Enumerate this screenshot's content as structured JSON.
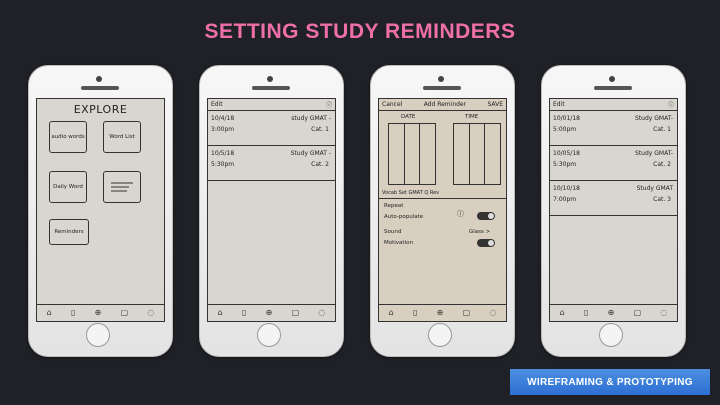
{
  "title": "SETTING STUDY REMINDERS",
  "badge": "WIREFRAMING & PROTOTYPING",
  "phone1": {
    "header": "EXPLORE",
    "tiles": [
      "audio words",
      "Word List",
      "Daily Word",
      "Reminders"
    ]
  },
  "phone2": {
    "edit": "Edit",
    "rows": [
      {
        "l1": "10/4/18",
        "l2": "3:00pm",
        "r1": "study GMAT -",
        "r2": "Cat. 1"
      },
      {
        "l1": "10/5/18",
        "l2": "5:30pm",
        "r1": "Study GMAT -",
        "r2": "Cat. 2"
      }
    ]
  },
  "phone3": {
    "cancel": "Cancel",
    "heading": "Add Reminder",
    "save": "SAVE",
    "date": "DATE",
    "time": "TIME",
    "footer": "Vocab Set GMAT Q Rev",
    "repeat": "Repeat",
    "auto": "Auto-populate",
    "sound": "Sound",
    "glass": "Glass >",
    "motivation": "Motivation"
  },
  "phone4": {
    "edit": "Edit",
    "rows": [
      {
        "l1": "10/01/18",
        "l2": "5:00pm",
        "r1": "Study GMAT-",
        "r2": "Cat. 1"
      },
      {
        "l1": "10/05/18",
        "l2": "5:30pm",
        "r1": "Study GMAT-",
        "r2": "Cat. 2"
      },
      {
        "l1": "10/10/18",
        "l2": "7:00pm",
        "r1": "Study GMAT",
        "r2": "Cat. 3"
      }
    ]
  },
  "icons": {
    "home": "⌂",
    "book": "▯",
    "plus": "⊕",
    "doc": "▢",
    "chat": "◌",
    "info": "ⓘ"
  }
}
